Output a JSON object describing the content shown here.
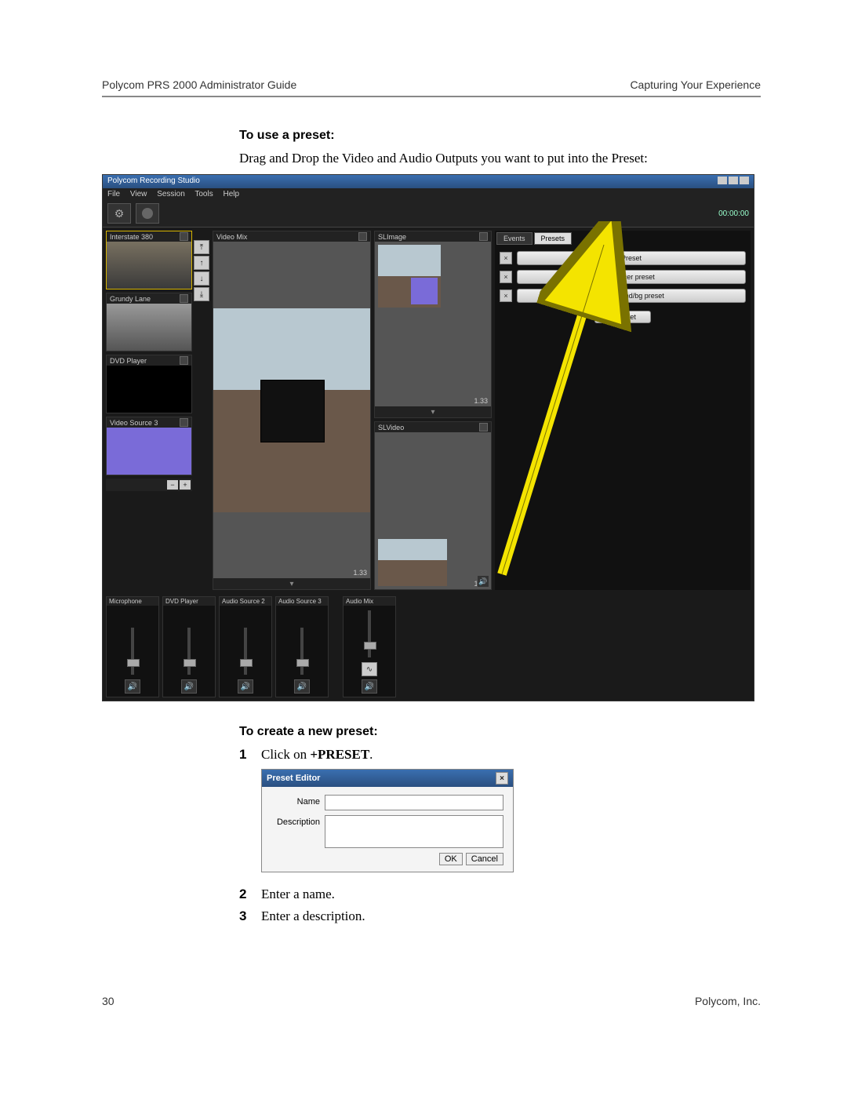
{
  "header": {
    "left": "Polycom PRS 2000 Administrator Guide",
    "right": "Capturing Your Experience"
  },
  "section1": {
    "heading": "To use a preset:",
    "body": "Drag and Drop the Video and Audio Outputs you want to put into the Preset:"
  },
  "app": {
    "title": "Polycom Recording Studio",
    "menu": [
      "File",
      "View",
      "Session",
      "Tools",
      "Help"
    ],
    "timecode": "00:00:00",
    "sources": {
      "items": [
        {
          "label": "Interstate 380"
        },
        {
          "label": "Grundy Lane"
        },
        {
          "label": "DVD Player"
        },
        {
          "label": "Video Source 3"
        }
      ],
      "add": "+",
      "remove": "−"
    },
    "videoMix": {
      "label": "Video Mix",
      "aspect": "1.33"
    },
    "slImage": {
      "label": "SLImage",
      "aspect": "1.33"
    },
    "slVideo": {
      "label": "SLVideo",
      "aspect": "1.33"
    },
    "tabs": {
      "events": "Events",
      "presets": "Presets"
    },
    "presets": {
      "items": [
        "Preset",
        "spencer preset",
        "foreground/bg preset"
      ],
      "add": "+ Preset"
    },
    "audio": [
      "Microphone",
      "DVD Player",
      "Audio Source 2",
      "Audio Source 3",
      "Audio Mix"
    ],
    "arrows": [
      "⤒",
      "↑",
      "↓",
      "⤓"
    ],
    "expand": "▾"
  },
  "section2": {
    "heading": "To create a new preset:",
    "step1_prefix": "Click on ",
    "step1_bold": "+PRESET",
    "step1_suffix": ".",
    "step2": "Enter a name.",
    "step3": "Enter a description."
  },
  "dialog": {
    "title": "Preset Editor",
    "name_label": "Name",
    "desc_label": "Description",
    "ok": "OK",
    "cancel": "Cancel"
  },
  "footer": {
    "page": "30",
    "company": "Polycom, Inc."
  }
}
